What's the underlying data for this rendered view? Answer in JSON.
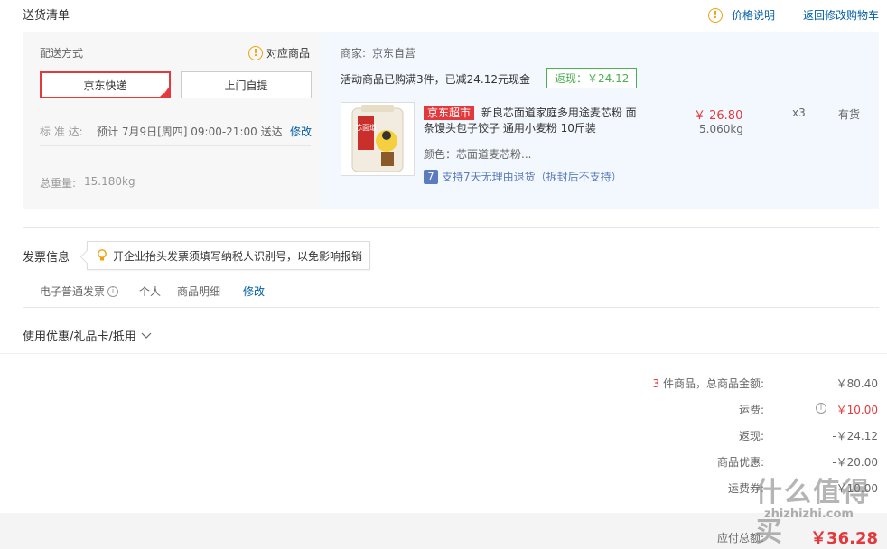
{
  "header": {
    "title": "送货清单",
    "price_note": "价格说明",
    "back_to_cart": "返回修改购物车"
  },
  "delivery": {
    "method_label": "配送方式",
    "matching_products": "对应商品",
    "option_selected": "京东快递",
    "option_pickup": "上门自提",
    "eta_label": "标 准 达:",
    "eta_value": "预计 7月9日[周四] 09:00-21:00 送达",
    "eta_modify": "修改",
    "weight_label": "总重量:",
    "weight_value": "15.180kg"
  },
  "merchant": {
    "label": "商家:",
    "name": "京东自营",
    "promo": "活动商品已购满3件，已减24.12元现金",
    "cashback": "返现：￥24.12"
  },
  "product": {
    "tag": "京东超市",
    "name_line1": "新良芯面道家庭多用途麦芯粉 面",
    "name_line2": "条馒头包子饺子 通用小麦粉 10斤装",
    "color": "颜色：芯面道麦芯粉...",
    "return_badge": "7",
    "return_policy": "支持7天无理由退货（拆封后不支持）",
    "price": "￥ 26.80",
    "weight": "5.060kg",
    "quantity": "x3",
    "stock": "有货",
    "image_text": "芯面道"
  },
  "invoice": {
    "title": "发票信息",
    "tooltip": "开企业抬头发票须填写纳税人识别号，以免影响报销",
    "type": "电子普通发票",
    "holder": "个人",
    "content": "商品明细",
    "modify": "修改"
  },
  "coupons": {
    "label": "使用优惠/礼品卡/抵用"
  },
  "summary": {
    "count": "3",
    "count_suffix": "件商品，总商品金额:",
    "total_value": "￥80.40",
    "shipping_label": "运费:",
    "shipping_value": "￥10.00",
    "cashback_label": "返现:",
    "cashback_value": "-￥24.12",
    "discount_label": "商品优惠:",
    "discount_value": "-￥20.00",
    "shipping_discount_label": "运费券:",
    "shipping_discount_value": "-￥10.00",
    "payable_label": "应付总额:",
    "payable_value": "￥36.28"
  },
  "watermark": "什么值得买",
  "watermark_url": "zhizhizhi.com",
  "colors": {
    "accent_red": "#e4393c",
    "link_blue": "#005ea7",
    "cashback_green": "#4caf50",
    "warning_orange": "#f0a30a"
  }
}
